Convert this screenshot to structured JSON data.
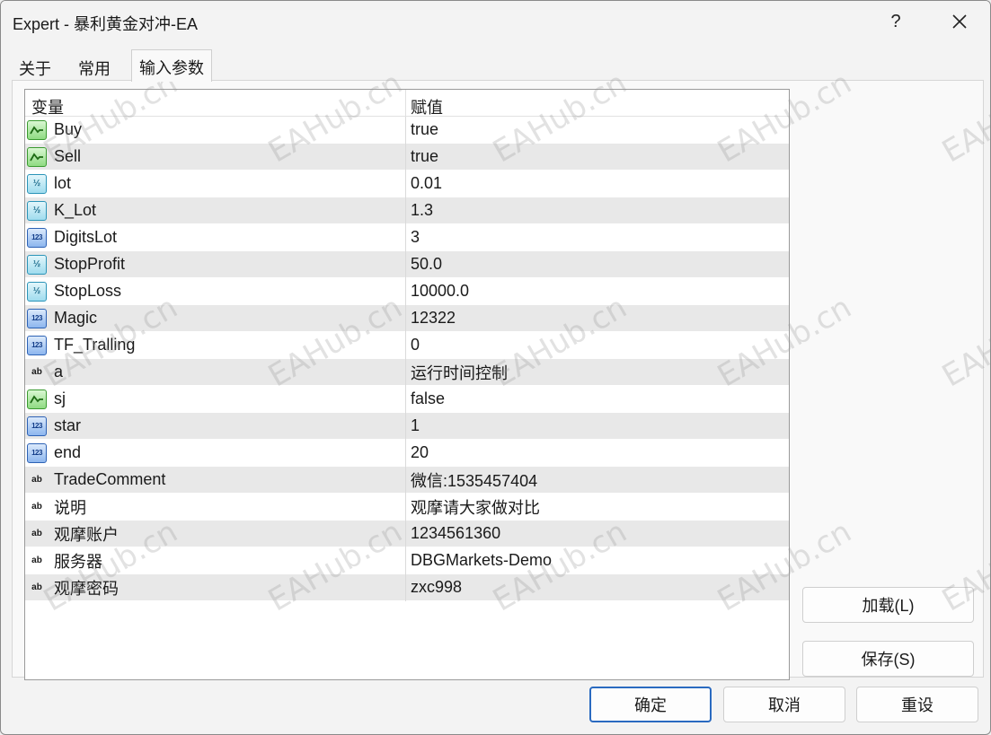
{
  "window": {
    "title": "Expert - 暴利黄金对冲-EA",
    "help_label": "?"
  },
  "tabs": [
    {
      "label": "关于"
    },
    {
      "label": "常用"
    },
    {
      "label": "输入参数"
    }
  ],
  "table": {
    "headers": {
      "variable": "变量",
      "value": "赋值"
    },
    "rows": [
      {
        "name": "Buy",
        "value": "true",
        "type": "bool"
      },
      {
        "name": "Sell",
        "value": "true",
        "type": "bool"
      },
      {
        "name": "lot",
        "value": "0.01",
        "type": "double"
      },
      {
        "name": "K_Lot",
        "value": "1.3",
        "type": "double"
      },
      {
        "name": "DigitsLot",
        "value": "3",
        "type": "int"
      },
      {
        "name": "StopProfit",
        "value": "50.0",
        "type": "double"
      },
      {
        "name": "StopLoss",
        "value": "10000.0",
        "type": "double"
      },
      {
        "name": "Magic",
        "value": "12322",
        "type": "int"
      },
      {
        "name": "TF_Tralling",
        "value": "0",
        "type": "int"
      },
      {
        "name": "a",
        "value": "运行时间控制",
        "type": "string"
      },
      {
        "name": "sj",
        "value": "false",
        "type": "bool"
      },
      {
        "name": "star",
        "value": "1",
        "type": "int"
      },
      {
        "name": "end",
        "value": "20",
        "type": "int"
      },
      {
        "name": "TradeComment",
        "value": "微信:1535457404",
        "type": "string"
      },
      {
        "name": "说明",
        "value": "观摩请大家做对比",
        "type": "string"
      },
      {
        "name": "观摩账户",
        "value": "1234561360",
        "type": "string"
      },
      {
        "name": "服务器",
        "value": "DBGMarkets-Demo",
        "type": "string"
      },
      {
        "name": "观摩密码",
        "value": "zxc998",
        "type": "string"
      }
    ]
  },
  "icons": {
    "bool": "bool-type-icon",
    "double": "double-type-icon",
    "int": "int-type-icon",
    "string": "string-type-icon",
    "glyphs": {
      "double": "½",
      "int": "123",
      "string": "ab"
    }
  },
  "buttons": {
    "load": "加载(L)",
    "save": "保存(S)",
    "ok": "确定",
    "cancel": "取消",
    "reset": "重设"
  },
  "watermark": "EAHub.cn",
  "colors": {
    "accent": "#2a6ac0",
    "row_alt": "#e8e8e8",
    "bool_icon": "#8fdb82",
    "string_icon": "#e8d06a"
  }
}
